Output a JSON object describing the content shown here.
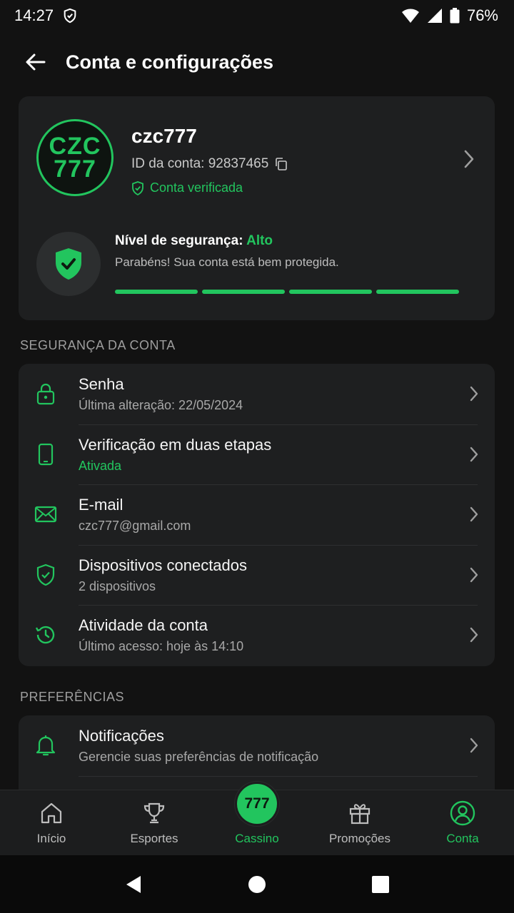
{
  "status_bar": {
    "time": "14:27",
    "battery": "76%"
  },
  "header": {
    "title": "Conta e configurações"
  },
  "profile": {
    "avatar_line1": "CZC",
    "avatar_line2": "777",
    "username": "czc777",
    "account_id": "ID da conta: 92837465",
    "verified": "Conta verificada",
    "security_label": "Nível de segurança:",
    "security_level": "Alto",
    "security_message": "Parabéns! Sua conta está bem protegida.",
    "security_progress": 1.0
  },
  "sections": {
    "security": {
      "header": "SEGURANÇA DA CONTA",
      "items": [
        {
          "title": "Senha",
          "subtitle": "Última alteração: 22/05/2024",
          "icon": "lock-icon"
        },
        {
          "title": "Verificação em duas etapas",
          "subtitle": "Ativada",
          "icon": "phone-icon"
        },
        {
          "title": "E-mail",
          "subtitle": "czc777@gmail.com",
          "icon": "mail-icon"
        },
        {
          "title": "Dispositivos conectados",
          "subtitle": "2 dispositivos",
          "icon": "shield-check-icon"
        },
        {
          "title": "Atividade da conta",
          "subtitle": "Último acesso: hoje às 14:10",
          "icon": "history-icon"
        }
      ]
    },
    "preferences": {
      "header": "PREFERÊNCIAS",
      "items": [
        {
          "title": "Notificações",
          "subtitle": "Gerencie suas preferências de notificação",
          "icon": "bell-icon"
        }
      ]
    }
  },
  "bottom_nav": {
    "items": [
      {
        "label": "Início",
        "icon": "home-icon"
      },
      {
        "label": "Esportes",
        "icon": "trophy-icon"
      },
      {
        "label": "Cassino",
        "badge": "777",
        "icon": "casino-icon"
      },
      {
        "label": "Promoções",
        "icon": "gift-icon"
      },
      {
        "label": "Conta",
        "icon": "account-icon",
        "active": true
      }
    ]
  },
  "colors": {
    "accent": "#22c55e",
    "background": "#121212",
    "card": "#1e1f20"
  }
}
